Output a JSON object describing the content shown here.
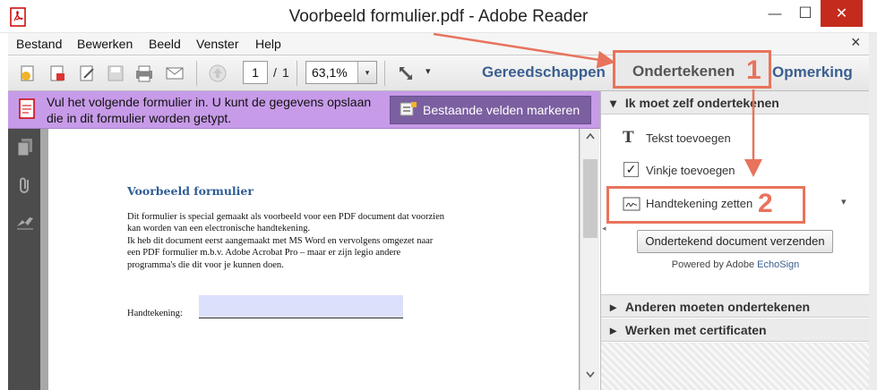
{
  "window": {
    "title": "Voorbeeld formulier.pdf - Adobe Reader",
    "minimize_glyph": "—",
    "maximize_glyph": "☐",
    "close_glyph": "✕",
    "doc_close_glyph": "×"
  },
  "menu": [
    "Bestand",
    "Bewerken",
    "Beeld",
    "Venster",
    "Help"
  ],
  "toolbar": {
    "page_current": "1",
    "page_separator": "/",
    "page_total": "1",
    "zoom": "63,1%",
    "dropdown_arrow": "▾",
    "more_arrow": "▾"
  },
  "tabs": {
    "tools": "Gereedschappen",
    "sign": "Ondertekenen",
    "comment": "Opmerking"
  },
  "formbar": {
    "message": "Vul het volgende formulier in. U kunt de gegevens opslaan die in dit formulier worden getypt.",
    "highlight_button": "Bestaande velden markeren"
  },
  "document": {
    "heading": "Voorbeeld formulier",
    "lines": [
      "Dit formulier is special gemaakt als voorbeeld voor een PDF document dat voorzien",
      "kan worden van een electronische handtekening.",
      "Ik heb dit document eerst aangemaakt met MS Word en vervolgens omgezet naar",
      "een PDF formulier m.b.v. Adobe Acrobat Pro – maar er zijn legio andere",
      "programma's die dit voor je kunnen doen."
    ],
    "signature_label": "Handtekening:"
  },
  "panel": {
    "section_self": "Ik moet zelf ondertekenen",
    "add_text": "Tekst toevoegen",
    "add_check": "Vinkje toevoegen",
    "place_signature": "Handtekening zetten",
    "send_signed": "Ondertekend document verzenden",
    "powered_by": "Powered by Adobe",
    "powered_brand": "EchoSign",
    "section_others": "Anderen moeten ondertekenen",
    "section_certs": "Werken met certificaten",
    "text_icon_glyph": "T",
    "check_glyph": "✓",
    "expand_glyph": "▾",
    "collapsed_glyph": "▸",
    "opened_glyph": "◂"
  },
  "annotations": {
    "step1": "1",
    "step2": "2",
    "color": "#e8735c"
  },
  "colors": {
    "tab_blue": "#3a5f90",
    "form_bar": "#c79be8",
    "mark_button": "#7b5fa0",
    "signature_field": "#dde0fb",
    "close_button": "#c42b1c"
  },
  "icons": [
    "pdf-app-icon",
    "open-icon",
    "create-pdf-icon",
    "edit-icon",
    "save-icon",
    "print-icon",
    "mail-icon",
    "previous-page-icon",
    "fullscreen-icon",
    "pages-icon",
    "attachment-icon",
    "signature-nav-icon",
    "form-icon",
    "highlight-fields-icon",
    "signature-pen-icon"
  ]
}
